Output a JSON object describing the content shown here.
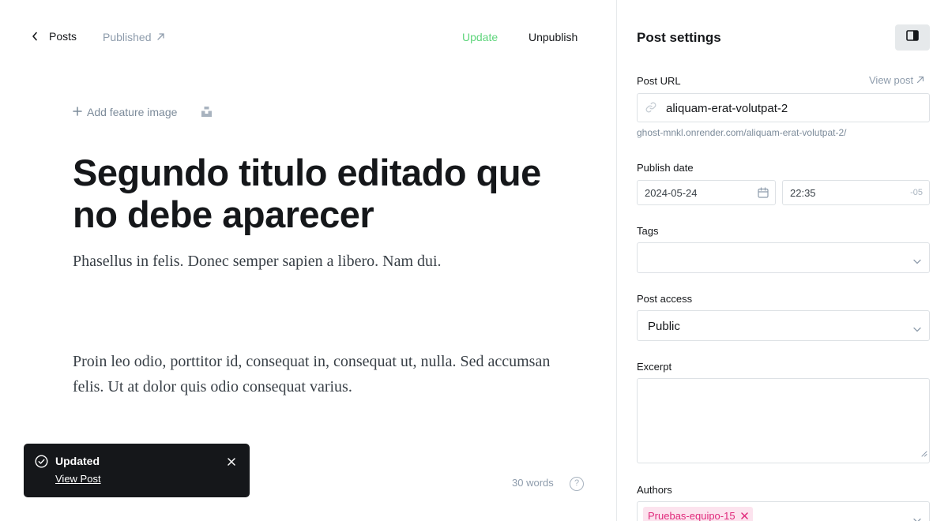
{
  "header": {
    "back_label": "Posts",
    "status_label": "Published",
    "update_label": "Update",
    "unpublish_label": "Unpublish"
  },
  "editor": {
    "feature_image_label": "Add feature image",
    "title": "Segundo titulo editado que no debe aparecer",
    "subtitle": "Phasellus in felis. Donec semper sapien a libero. Nam dui.",
    "body": "Proin leo odio, porttitor id, consequat in, consequat ut, nulla. Sed accumsan felis. Ut at dolor quis odio consequat varius.",
    "word_count": "30 words",
    "help_glyph": "?"
  },
  "toast": {
    "title": "Updated",
    "link": "View Post"
  },
  "settings": {
    "title": "Post settings",
    "post_url_label": "Post URL",
    "view_post_label": "View post",
    "post_url_value": "aliquam-erat-volutpat-2",
    "post_url_full": "ghost-mnkl.onrender.com/aliquam-erat-volutpat-2/",
    "publish_date_label": "Publish date",
    "publish_date": "2024-05-24",
    "publish_time": "22:35",
    "timezone": "-05",
    "tags_label": "Tags",
    "post_access_label": "Post access",
    "post_access_value": "Public",
    "excerpt_label": "Excerpt",
    "authors_label": "Authors",
    "authors": [
      "Pruebas-equipo-15"
    ]
  },
  "colors": {
    "accent_green": "#5fd57c",
    "author_chip_bg": "#fce3ee",
    "author_chip_text": "#e0297b",
    "toast_bg": "#15171a"
  },
  "icons": {
    "back": "chevron-left-icon",
    "status": "arrow-up-right-icon",
    "feature": "plus-icon",
    "unsplash": "unsplash-icon",
    "panel": "sidebar-toggle-icon",
    "link": "link-icon",
    "calendar": "calendar-icon",
    "check": "check-circle-icon",
    "close": "close-icon"
  }
}
